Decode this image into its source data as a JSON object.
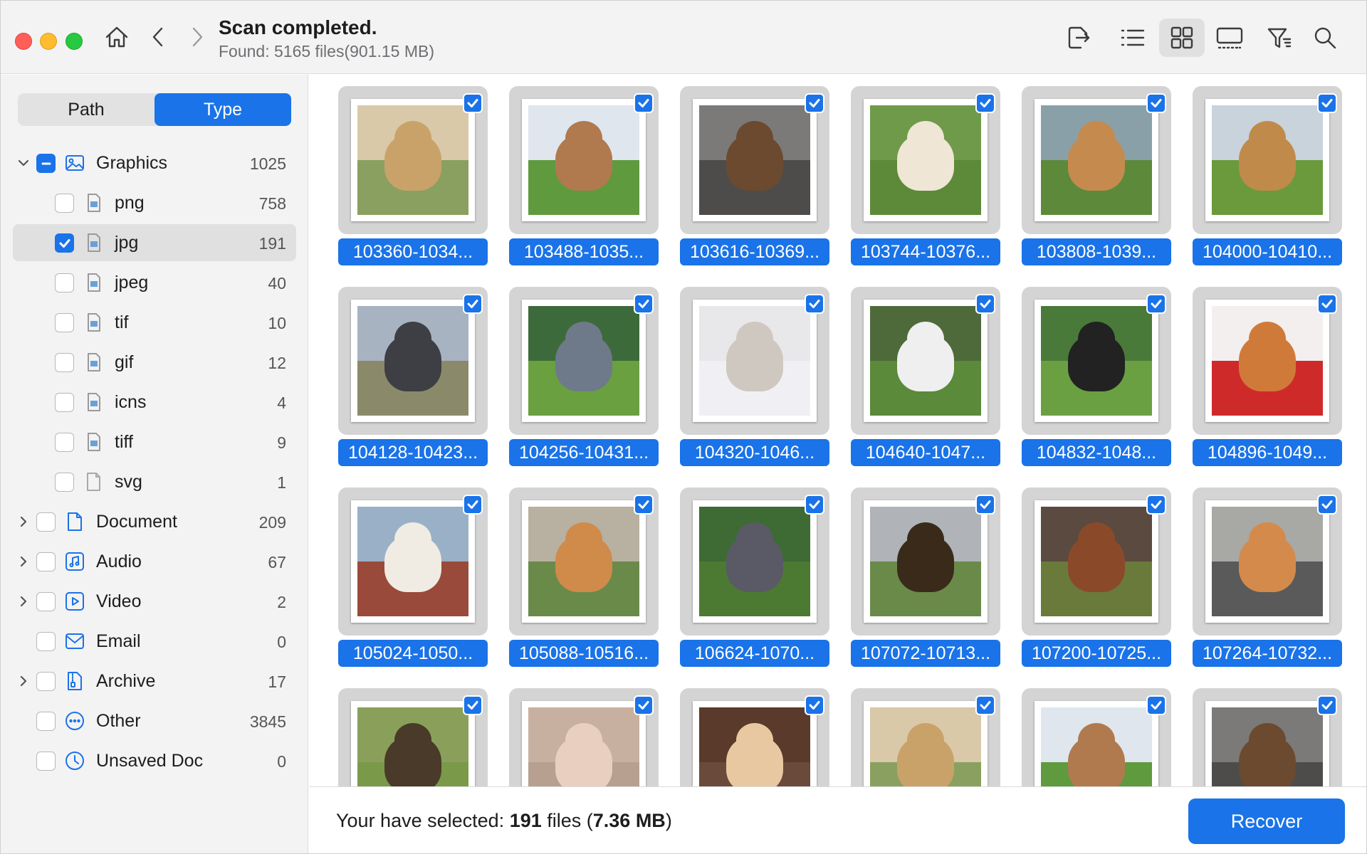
{
  "header": {
    "title": "Scan completed.",
    "subtitle": "Found: 5165 files(901.15 MB)",
    "icons": [
      "home-icon",
      "back-icon",
      "forward-icon",
      "export-icon",
      "list-view-icon",
      "grid-view-icon",
      "filmstrip-view-icon",
      "filter-icon",
      "search-icon"
    ],
    "active_view": "grid"
  },
  "sidebar": {
    "tabs": [
      "Path",
      "Type"
    ],
    "active_tab": "Type",
    "tree": [
      {
        "label": "Graphics",
        "count": "1025",
        "level": 0,
        "expanded": true,
        "check": "mixed",
        "icon": "image-icon"
      },
      {
        "label": "png",
        "count": "758",
        "level": 1,
        "check": "unchecked",
        "icon": "image-file-icon"
      },
      {
        "label": "jpg",
        "count": "191",
        "level": 1,
        "check": "checked",
        "icon": "image-file-icon",
        "selected": true
      },
      {
        "label": "jpeg",
        "count": "40",
        "level": 1,
        "check": "unchecked",
        "icon": "image-file-icon"
      },
      {
        "label": "tif",
        "count": "10",
        "level": 1,
        "check": "unchecked",
        "icon": "image-file-icon"
      },
      {
        "label": "gif",
        "count": "12",
        "level": 1,
        "check": "unchecked",
        "icon": "image-file-icon"
      },
      {
        "label": "icns",
        "count": "4",
        "level": 1,
        "check": "unchecked",
        "icon": "image-file-icon"
      },
      {
        "label": "tiff",
        "count": "9",
        "level": 1,
        "check": "unchecked",
        "icon": "image-file-icon"
      },
      {
        "label": "svg",
        "count": "1",
        "level": 1,
        "check": "unchecked",
        "icon": "blank-file-icon"
      },
      {
        "label": "Document",
        "count": "209",
        "level": 0,
        "expanded": false,
        "check": "unchecked",
        "icon": "document-icon"
      },
      {
        "label": "Audio",
        "count": "67",
        "level": 0,
        "expanded": false,
        "check": "unchecked",
        "icon": "audio-icon"
      },
      {
        "label": "Video",
        "count": "2",
        "level": 0,
        "expanded": false,
        "check": "unchecked",
        "icon": "video-icon"
      },
      {
        "label": "Email",
        "count": "0",
        "level": 0,
        "check": "unchecked",
        "icon": "email-icon"
      },
      {
        "label": "Archive",
        "count": "17",
        "level": 0,
        "expanded": false,
        "check": "unchecked",
        "icon": "archive-icon"
      },
      {
        "label": "Other",
        "count": "3845",
        "level": 0,
        "check": "unchecked",
        "icon": "other-icon"
      },
      {
        "label": "Unsaved Doc",
        "count": "0",
        "level": 0,
        "check": "unchecked",
        "icon": "clock-icon"
      }
    ]
  },
  "grid": {
    "items": [
      {
        "name": "103360-1034...",
        "checked": true,
        "colors": [
          "#d9c9a8",
          "#c9a26a",
          "#8aa060"
        ]
      },
      {
        "name": "103488-1035...",
        "checked": true,
        "colors": [
          "#dfe6ee",
          "#b07a4e",
          "#5f9a3e"
        ]
      },
      {
        "name": "103616-10369...",
        "checked": true,
        "colors": [
          "#7b7a78",
          "#6b4a30",
          "#4d4c4a"
        ]
      },
      {
        "name": "103744-10376...",
        "checked": true,
        "colors": [
          "#6f9a4a",
          "#efe6d6",
          "#5d8a38"
        ]
      },
      {
        "name": "103808-1039...",
        "checked": true,
        "colors": [
          "#8aa0a8",
          "#c58a4e",
          "#5c8a3a"
        ]
      },
      {
        "name": "104000-10410...",
        "checked": true,
        "colors": [
          "#c8d3dc",
          "#c08a4a",
          "#6a9a3c"
        ]
      },
      {
        "name": "104128-10423...",
        "checked": true,
        "colors": [
          "#a7b3c0",
          "#3e3f44",
          "#8a8a6a"
        ]
      },
      {
        "name": "104256-10431...",
        "checked": true,
        "colors": [
          "#3d6a3a",
          "#6e7a8a",
          "#6aa040"
        ]
      },
      {
        "name": "104320-1046...",
        "checked": true,
        "colors": [
          "#e8e8ea",
          "#cfc8c0",
          "#f0f0f4"
        ]
      },
      {
        "name": "104640-1047...",
        "checked": true,
        "colors": [
          "#4e6a3a",
          "#efefef",
          "#5a8a3a"
        ]
      },
      {
        "name": "104832-1048...",
        "checked": true,
        "colors": [
          "#4a7a3a",
          "#222222",
          "#6aa042"
        ]
      },
      {
        "name": "104896-1049...",
        "checked": true,
        "colors": [
          "#f2efee",
          "#d07a3a",
          "#cf2a2a"
        ]
      },
      {
        "name": "105024-1050...",
        "checked": true,
        "colors": [
          "#9ab0c6",
          "#f0ece4",
          "#9a4a3a"
        ]
      },
      {
        "name": "105088-10516...",
        "checked": true,
        "colors": [
          "#b8b0a0",
          "#d08a4a",
          "#6a8a4a"
        ]
      },
      {
        "name": "106624-1070...",
        "checked": true,
        "colors": [
          "#3e6a34",
          "#5a5a66",
          "#4c7a32"
        ]
      },
      {
        "name": "107072-10713...",
        "checked": true,
        "colors": [
          "#b0b4b8",
          "#3a2a1a",
          "#6a8a4a"
        ]
      },
      {
        "name": "107200-10725...",
        "checked": true,
        "colors": [
          "#5a4a40",
          "#8a4a2a",
          "#6a7a3a"
        ]
      },
      {
        "name": "107264-10732...",
        "checked": true,
        "colors": [
          "#a8a8a4",
          "#d48a4a",
          "#5a5a5a"
        ]
      },
      {
        "name": "",
        "checked": true,
        "colors": [
          "#8aa05a",
          "#4a3a2a",
          "#7a9a4a"
        ]
      },
      {
        "name": "",
        "checked": true,
        "colors": [
          "#c8b0a0",
          "#e8cfc0",
          "#b8a090"
        ]
      },
      {
        "name": "",
        "checked": true,
        "colors": [
          "#5a3a2a",
          "#e8c8a0",
          "#6a4a3a"
        ]
      },
      {
        "name": "",
        "checked": true,
        "colors": [
          "#d9c9a8",
          "#c9a26a",
          "#8aa060"
        ]
      },
      {
        "name": "",
        "checked": true,
        "colors": [
          "#dfe6ee",
          "#b07a4e",
          "#5f9a3e"
        ]
      },
      {
        "name": "",
        "checked": true,
        "colors": [
          "#7b7a78",
          "#6b4a30",
          "#4d4c4a"
        ]
      }
    ]
  },
  "footer": {
    "selected_prefix": "Your have selected: ",
    "selected_count": "191",
    "selected_mid": " files (",
    "selected_size": "7.36 MB",
    "selected_suffix": ")",
    "recover_label": "Recover"
  },
  "colors": {
    "accent": "#1a73e8",
    "close": "#ff5f57",
    "minimize": "#febc2e",
    "zoom": "#28c840"
  }
}
